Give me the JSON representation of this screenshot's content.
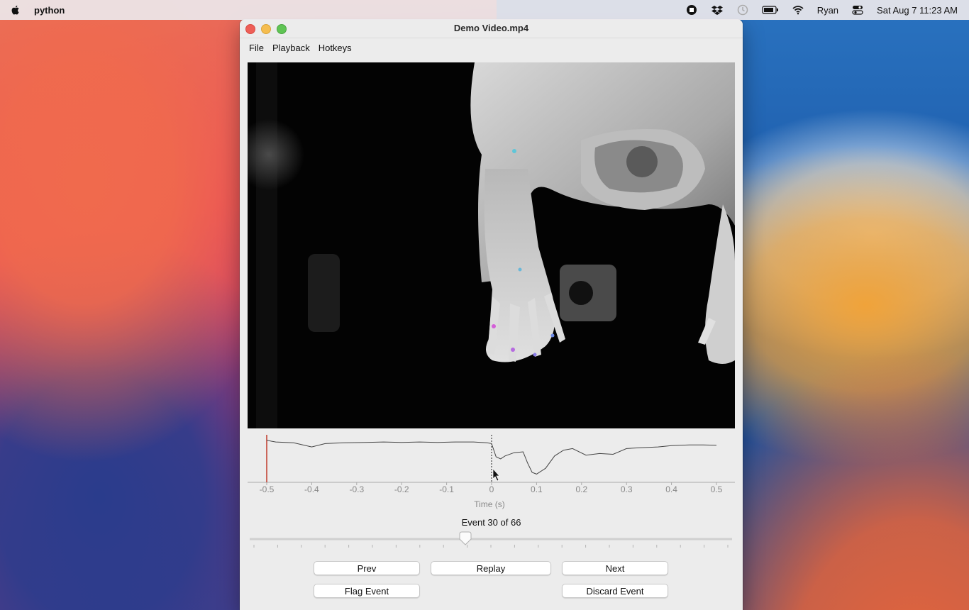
{
  "menubar": {
    "app_name": "python",
    "user": "Ryan",
    "datetime": "Sat Aug 7  11:23 AM",
    "icons": [
      "apple-icon",
      "record-icon",
      "dropbox-icon",
      "clock-icon",
      "battery-icon",
      "wifi-icon",
      "control-center-icon"
    ]
  },
  "window": {
    "title": "Demo Video.mp4",
    "menu": [
      "File",
      "Playback",
      "Hotkeys"
    ]
  },
  "plot": {
    "xlabel": "Time (s)",
    "x_ticks": [
      "-0.5",
      "-0.4",
      "-0.3",
      "-0.2",
      "-0.1",
      "0",
      "0.1",
      "0.2",
      "0.3",
      "0.4",
      "0.5"
    ],
    "xlim": [
      -0.5,
      0.5
    ],
    "event_marker_x": -0.5,
    "current_time_x": 0,
    "trace": [
      [
        -0.5,
        0.9
      ],
      [
        -0.48,
        0.86
      ],
      [
        -0.44,
        0.84
      ],
      [
        -0.4,
        0.74
      ],
      [
        -0.37,
        0.82
      ],
      [
        -0.33,
        0.84
      ],
      [
        -0.28,
        0.85
      ],
      [
        -0.24,
        0.86
      ],
      [
        -0.2,
        0.85
      ],
      [
        -0.16,
        0.86
      ],
      [
        -0.12,
        0.85
      ],
      [
        -0.08,
        0.86
      ],
      [
        -0.04,
        0.86
      ],
      [
        -0.01,
        0.84
      ],
      [
        0,
        0.82
      ],
      [
        0.01,
        0.5
      ],
      [
        0.02,
        0.45
      ],
      [
        0.03,
        0.52
      ],
      [
        0.05,
        0.6
      ],
      [
        0.07,
        0.62
      ],
      [
        0.08,
        0.35
      ],
      [
        0.09,
        0.12
      ],
      [
        0.1,
        0.08
      ],
      [
        0.12,
        0.22
      ],
      [
        0.14,
        0.52
      ],
      [
        0.16,
        0.66
      ],
      [
        0.18,
        0.7
      ],
      [
        0.21,
        0.54
      ],
      [
        0.24,
        0.58
      ],
      [
        0.27,
        0.56
      ],
      [
        0.3,
        0.7
      ],
      [
        0.33,
        0.72
      ],
      [
        0.37,
        0.74
      ],
      [
        0.4,
        0.77
      ],
      [
        0.44,
        0.79
      ],
      [
        0.47,
        0.79
      ],
      [
        0.5,
        0.78
      ]
    ],
    "trace_color": "#444444",
    "marker_color": "#c0392b"
  },
  "event": {
    "label": "Event 30 of 66",
    "current": 30,
    "total": 66
  },
  "buttons": {
    "prev": "Prev",
    "replay": "Replay",
    "next": "Next",
    "flag": "Flag Event",
    "discard": "Discard Event"
  }
}
